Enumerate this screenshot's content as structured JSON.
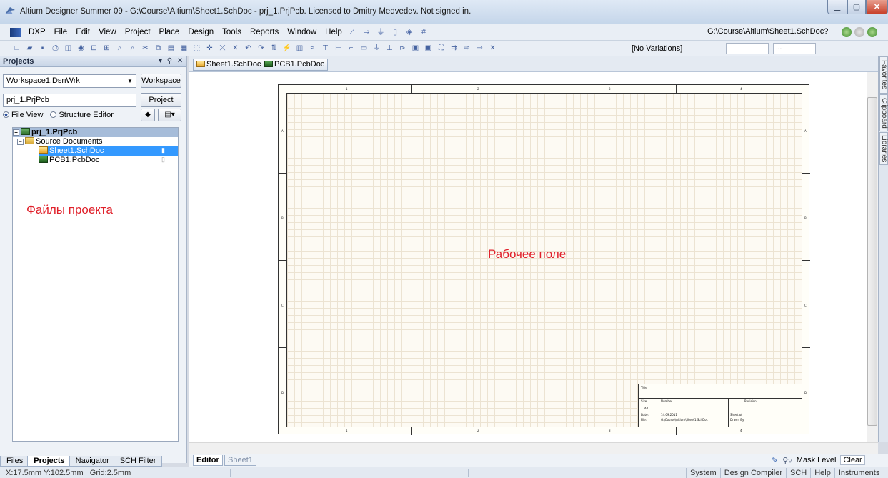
{
  "window": {
    "title": "Altium Designer Summer 09 - G:\\Course\\Altium\\Sheet1.SchDoc - prj_1.PrjPcb. Licensed to Dmitry Medvedev. Not signed in."
  },
  "menu": {
    "items": [
      "DXP",
      "File",
      "Edit",
      "View",
      "Project",
      "Place",
      "Design",
      "Tools",
      "Reports",
      "Window",
      "Help"
    ],
    "path": "G:\\Course\\Altium\\Sheet1.SchDoc?"
  },
  "toolbar": {
    "variations": "[No Variations]",
    "sel1": "",
    "sel2": "..."
  },
  "projects_panel": {
    "title": "Projects",
    "workspace_value": "Workspace1.DsnWrk",
    "workspace_button": "Workspace",
    "project_value": "prj_1.PrjPcb",
    "project_button": "Project",
    "file_view_label": "File View",
    "structure_editor_label": "Structure Editor",
    "tree": {
      "project": "prj_1.PrjPcb",
      "folder": "Source Documents",
      "docs": [
        "Sheet1.SchDoc",
        "PCB1.PcbDoc"
      ]
    },
    "annotation": "Файлы проекта",
    "tabs": [
      "Files",
      "Projects",
      "Navigator",
      "SCH Filter"
    ]
  },
  "document_tabs": [
    "Sheet1.SchDoc",
    "PCB1.PcbDoc"
  ],
  "workspace": {
    "annotation": "Рабочее поле",
    "zone_columns": [
      "1",
      "2",
      "3",
      "4"
    ],
    "zone_rows": [
      "A",
      "B",
      "C",
      "D"
    ],
    "title_block": {
      "title": "Title",
      "size": "Size",
      "size_value": "A4",
      "number": "Number",
      "revision": "Revision",
      "date": "Date:",
      "date_value": "14.09.2011",
      "sheet": "Sheet of",
      "file": "File:",
      "file_value": "G:\\Course\\Altium\\Sheet1.SchDoc",
      "drawn_by": "Drawn By:"
    }
  },
  "side_tabs": [
    "Favorites",
    "Clipboard",
    "Libraries"
  ],
  "editor_tabs": [
    "Editor",
    "Sheet1"
  ],
  "mask": {
    "label": "Mask Level",
    "clear": "Clear"
  },
  "status": {
    "coords": "X:17.5mm Y:102.5mm",
    "grid": "Grid:2.5mm",
    "buttons": [
      "System",
      "Design Compiler",
      "SCH",
      "Help",
      "Instruments"
    ]
  }
}
